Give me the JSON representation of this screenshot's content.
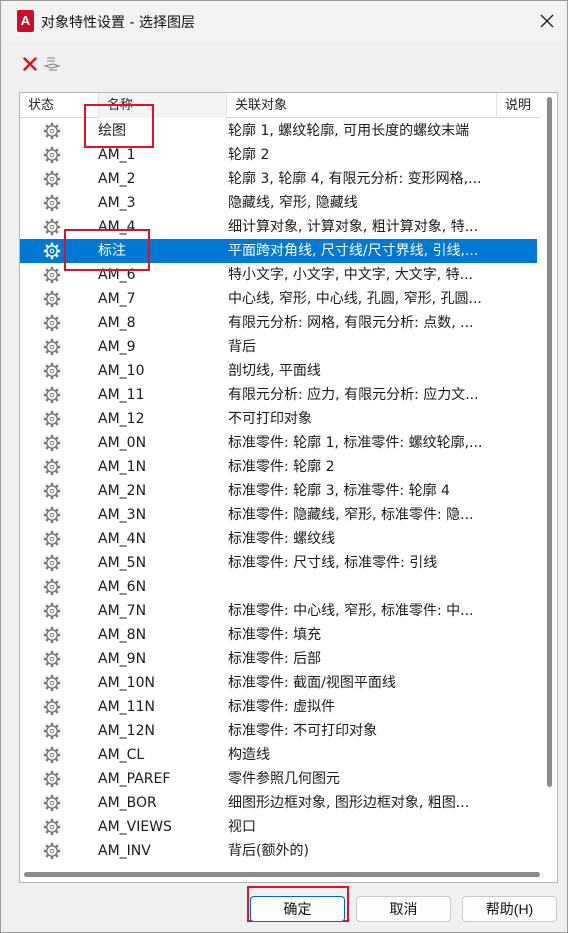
{
  "window": {
    "title": "对象特性设置 - 选择图层",
    "app_icon": "A"
  },
  "toolbar": {
    "buttons": [
      {
        "icon": "delete-x-icon"
      },
      {
        "icon": "rename-layer-icon"
      }
    ]
  },
  "columns": {
    "status": "状态",
    "name": "名称",
    "assoc": "关联对象",
    "desc": "说明"
  },
  "rows": [
    {
      "name": "绘图",
      "assoc": "轮廓 1, 螺纹轮廓, 可用长度的螺纹末端"
    },
    {
      "name": "AM_1",
      "assoc": "轮廓 2"
    },
    {
      "name": "AM_2",
      "assoc": "轮廓 3, 轮廓 4, 有限元分析: 变形网格,..."
    },
    {
      "name": "AM_3",
      "assoc": "隐藏线, 窄形, 隐藏线"
    },
    {
      "name": "AM_4",
      "assoc": "细计算对象, 计算对象, 粗计算对象, 特..."
    },
    {
      "name": "标注",
      "assoc": "平面跨对角线, 尺寸线/尺寸界线, 引线,...",
      "selected": true
    },
    {
      "name": "AM_6",
      "assoc": "特小文字, 小文字, 中文字, 大文字, 特..."
    },
    {
      "name": "AM_7",
      "assoc": "中心线, 窄形, 中心线, 孔圆, 窄形, 孔圆..."
    },
    {
      "name": "AM_8",
      "assoc": "有限元分析: 网格, 有限元分析: 点数, ..."
    },
    {
      "name": "AM_9",
      "assoc": "背后"
    },
    {
      "name": "AM_10",
      "assoc": "剖切线, 平面线"
    },
    {
      "name": "AM_11",
      "assoc": "有限元分析: 应力, 有限元分析: 应力文..."
    },
    {
      "name": "AM_12",
      "assoc": "不可打印对象"
    },
    {
      "name": "AM_0N",
      "assoc": "标准零件: 轮廓 1, 标准零件: 螺纹轮廓,..."
    },
    {
      "name": "AM_1N",
      "assoc": "标准零件: 轮廓 2"
    },
    {
      "name": "AM_2N",
      "assoc": "标准零件: 轮廓 3, 标准零件: 轮廓 4"
    },
    {
      "name": "AM_3N",
      "assoc": "标准零件: 隐藏线, 窄形, 标准零件: 隐..."
    },
    {
      "name": "AM_4N",
      "assoc": "标准零件: 螺纹线"
    },
    {
      "name": "AM_5N",
      "assoc": "标准零件: 尺寸线, 标准零件: 引线"
    },
    {
      "name": "AM_6N",
      "assoc": ""
    },
    {
      "name": "AM_7N",
      "assoc": "标准零件: 中心线, 窄形, 标准零件: 中..."
    },
    {
      "name": "AM_8N",
      "assoc": "标准零件: 填充"
    },
    {
      "name": "AM_9N",
      "assoc": "标准零件: 后部"
    },
    {
      "name": "AM_10N",
      "assoc": "标准零件: 截面/视图平面线"
    },
    {
      "name": "AM_11N",
      "assoc": "标准零件: 虚拟件"
    },
    {
      "name": "AM_12N",
      "assoc": "标准零件: 不可打印对象"
    },
    {
      "name": "AM_CL",
      "assoc": "构造线"
    },
    {
      "name": "AM_PAREF",
      "assoc": "零件参照几何图元"
    },
    {
      "name": "AM_BOR",
      "assoc": "细图形边框对象, 图形边框对象, 粗图..."
    },
    {
      "name": "AM_VIEWS",
      "assoc": "视口"
    },
    {
      "name": "AM_INV",
      "assoc": "背后(额外的)"
    }
  ],
  "buttons": {
    "ok": "确定",
    "cancel": "取消",
    "help": "帮助(H)"
  },
  "colors": {
    "selection": "#0078d4",
    "annotation": "#e0102a",
    "app_icon": "#c8102e"
  }
}
